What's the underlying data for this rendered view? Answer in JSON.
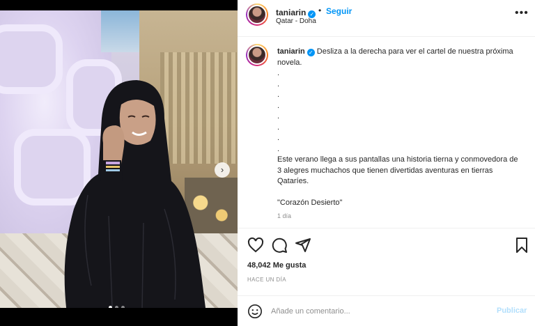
{
  "post": {
    "username": "taniarin",
    "follow_label": "Seguir",
    "separator": "•",
    "location": "Qatar - Doha",
    "more_icon": "more-horizontal-icon"
  },
  "caption": {
    "username": "taniarin",
    "line1": "Desliza a la derecha para ver el cartel de nuestra próxima novela.",
    "dots": [
      ".",
      ".",
      ".",
      ".",
      ".",
      ".",
      ".",
      "."
    ],
    "paragraph": "Este verano llega a sus pantallas una historia tierna y conmovedora de 3 alegres muchachos que tienen divertidas aventuras en tierras Qataríes.",
    "title": "\"Corazón Desierto\"",
    "time": "1 día"
  },
  "carousel": {
    "next_icon": "chevron-right-icon",
    "next_glyph": "›",
    "slide_count": 3,
    "active_slide": 1
  },
  "actions": {
    "like_icon": "heart-icon",
    "comment_icon": "comment-icon",
    "share_icon": "send-icon",
    "save_icon": "bookmark-icon"
  },
  "likes": {
    "text": "48,042 Me gusta"
  },
  "posted": {
    "text": "HACE UN DÍA"
  },
  "comment": {
    "placeholder": "Añade un comentario...",
    "publish_label": "Publicar",
    "emoji_icon": "emoji-icon"
  },
  "colors": {
    "accent": "#0095f6",
    "publish_disabled": "#b2dffc"
  }
}
